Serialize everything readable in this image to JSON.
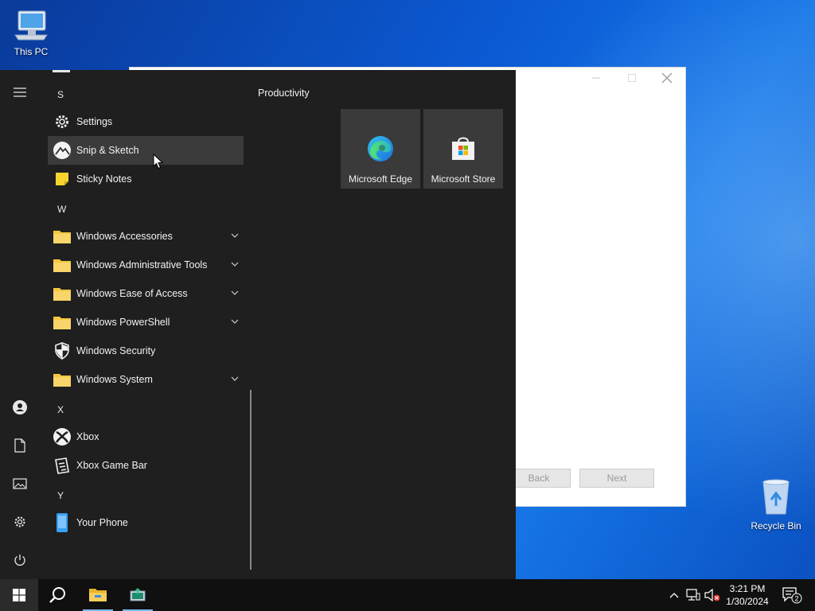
{
  "desktop": {
    "this_pc_label": "This PC",
    "recycle_bin_label": "Recycle Bin"
  },
  "background_window": {
    "minimize_icon": "minimize-icon",
    "maximize_icon": "maximize-icon",
    "close_icon": "close-icon",
    "back_label": "Back",
    "next_label": "Next"
  },
  "start_menu": {
    "rail": [
      "hamburger-menu-icon",
      "user-icon",
      "documents-icon",
      "pictures-icon",
      "settings-gear-icon",
      "power-icon"
    ],
    "letters": {
      "s": "S",
      "w": "W",
      "x": "X",
      "y": "Y"
    },
    "apps": {
      "settings": "Settings",
      "snip_sketch": "Snip & Sketch",
      "sticky_notes": "Sticky Notes",
      "win_accessories": "Windows Accessories",
      "win_admin_tools": "Windows Administrative Tools",
      "win_ease_access": "Windows Ease of Access",
      "win_powershell": "Windows PowerShell",
      "win_security": "Windows Security",
      "win_system": "Windows System",
      "xbox": "Xbox",
      "xbox_game_bar": "Xbox Game Bar",
      "your_phone": "Your Phone"
    },
    "group_title": "Productivity",
    "tiles": {
      "edge": "Microsoft Edge",
      "store": "Microsoft Store"
    }
  },
  "taskbar": {
    "time": "3:21 PM",
    "date": "1/30/2024",
    "notification_count": "2"
  },
  "colors": {
    "start_menu_bg": "#1f1f1f",
    "tile_bg": "#3a3a3a",
    "folder_yellow": "#f3c740",
    "taskbar_bg": "#101010",
    "accent": "#76b9ed"
  }
}
